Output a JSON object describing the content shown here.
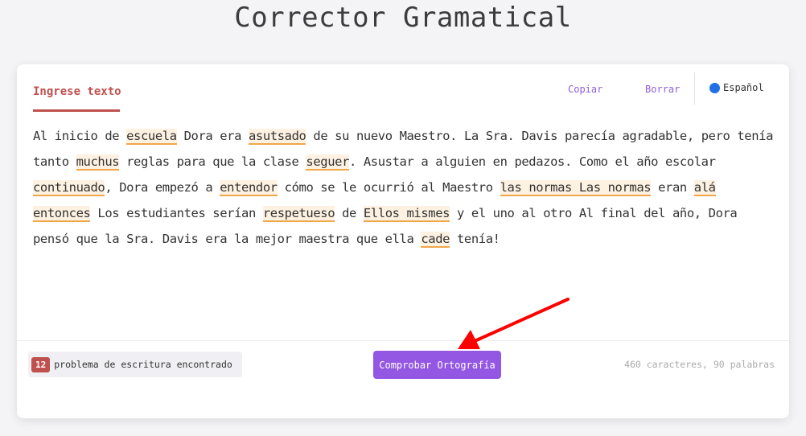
{
  "page_title": "Corrector Gramatical",
  "header": {
    "tab_label": "Ingrese texto",
    "copy_label": "Copiar",
    "clear_label": "Borrar",
    "language_label": "Español"
  },
  "text_segments": [
    {
      "t": "Al inicio de ",
      "e": false
    },
    {
      "t": "escuela",
      "e": true
    },
    {
      "t": " Dora era ",
      "e": false
    },
    {
      "t": "asutsado",
      "e": true
    },
    {
      "t": " de su nuevo Maestro. La Sra. Davis parecía agradable, pero tenía tanto ",
      "e": false
    },
    {
      "t": "muchus",
      "e": true
    },
    {
      "t": " reglas para que la clase ",
      "e": false
    },
    {
      "t": "seguer",
      "e": true
    },
    {
      "t": ". Asustar a alguien en pedazos. Como el año escolar ",
      "e": false
    },
    {
      "t": "continuado",
      "e": true
    },
    {
      "t": ", Dora empezó a ",
      "e": false
    },
    {
      "t": "entendor",
      "e": true
    },
    {
      "t": " cómo se le ocurrió al Maestro ",
      "e": false
    },
    {
      "t": "las normas Las normas",
      "e": true
    },
    {
      "t": " eran ",
      "e": false
    },
    {
      "t": "alá entonces",
      "e": true
    },
    {
      "t": " Los estudiantes serían ",
      "e": false
    },
    {
      "t": "respetueso",
      "e": true
    },
    {
      "t": " de ",
      "e": false
    },
    {
      "t": "Ellos mismes",
      "e": true
    },
    {
      "t": " y el uno al otro Al final del año, Dora pensó que la Sra. Davis era la mejor maestra que ella ",
      "e": false
    },
    {
      "t": "cade",
      "e": true
    },
    {
      "t": " tenía!",
      "e": false
    }
  ],
  "footer": {
    "issue_count": "12",
    "issue_label": "problema de escritura encontrado",
    "check_button_label": "Comprobar Ortografía",
    "stats_text": "460 caracteres, 90 palabras"
  },
  "colors": {
    "accent_red": "#c0504d",
    "accent_purple": "#9457e3",
    "highlight_bg": "#fdf1e1",
    "highlight_underline": "#f0a64a",
    "language_dot": "#1f6fe5",
    "annotation_arrow": "#ff0000"
  },
  "icons": {
    "language": "blue-circle-icon",
    "annotation": "red-arrow-icon"
  }
}
